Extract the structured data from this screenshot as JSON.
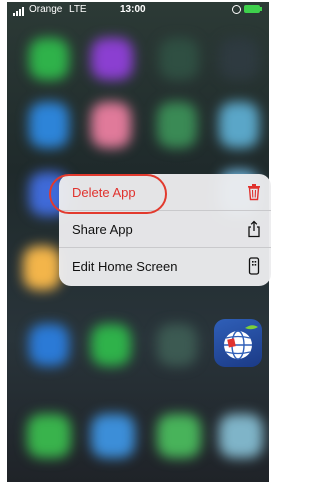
{
  "status_bar": {
    "carrier": "Orange",
    "network": "LTE",
    "time": "13:00",
    "signal_bars": 4,
    "rotation_icon": "rotation-lock-icon",
    "battery_icon": "battery-charging-icon"
  },
  "context_menu": {
    "items": [
      {
        "label": "Delete App",
        "icon": "trash-icon",
        "destructive": true
      },
      {
        "label": "Share App",
        "icon": "share-icon",
        "destructive": false
      },
      {
        "label": "Edit Home Screen",
        "icon": "phone-icon",
        "destructive": false
      }
    ]
  },
  "selected_app": {
    "icon": "globe-app-icon"
  },
  "colors": {
    "destructive": "#e0322e",
    "highlight_ring": "#e23a2e",
    "battery": "#3ed14c"
  }
}
